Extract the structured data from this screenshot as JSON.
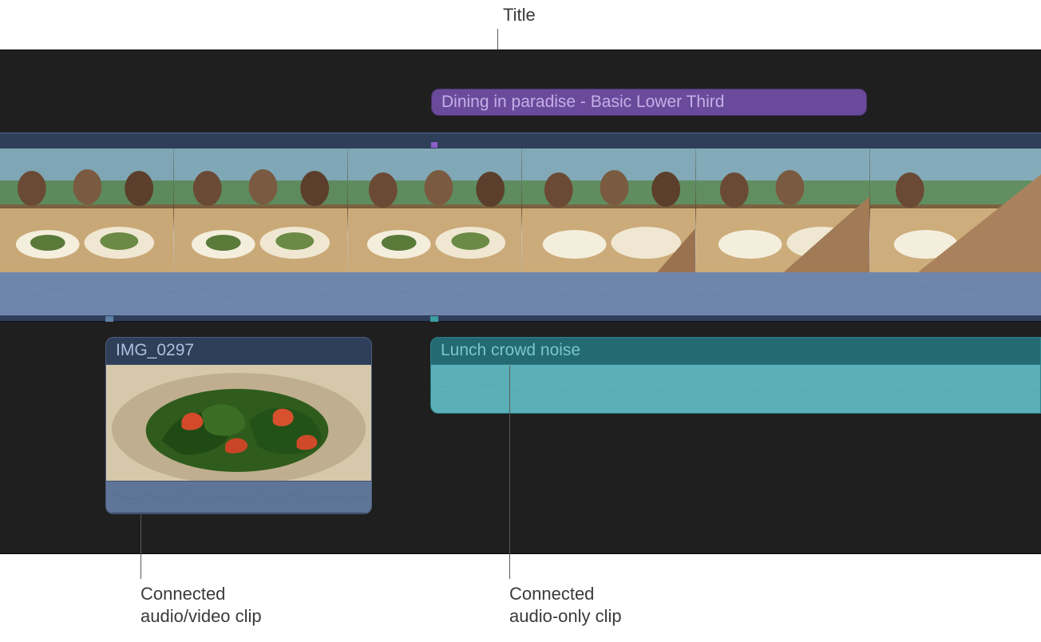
{
  "annotations": {
    "title": "Title",
    "connected_av_line1": "Connected",
    "connected_av_line2": "audio/video clip",
    "connected_audio_line1": "Connected",
    "connected_audio_line2": "audio-only clip"
  },
  "tracks": {
    "title_clip": {
      "label": "Dining in paradise - Basic Lower Third",
      "color": "#6a4a9a"
    }
  },
  "connected_clips": {
    "video_clip": {
      "label": "IMG_0297"
    },
    "audio_clip": {
      "label": "Lunch crowd noise"
    }
  }
}
